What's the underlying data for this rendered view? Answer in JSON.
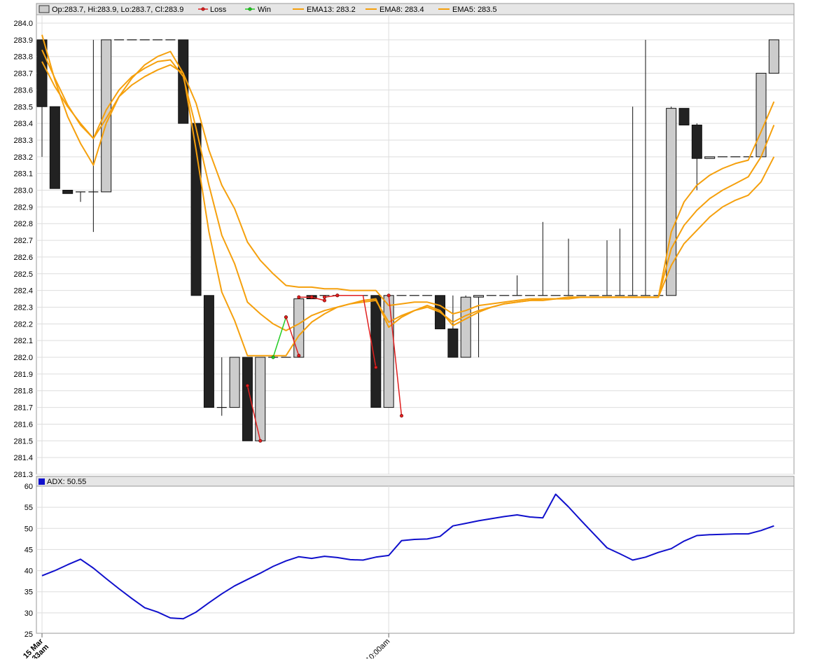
{
  "legend": {
    "ohlc": "Op:283.7, Hi:283.9, Lo:283.7, Cl:283.9",
    "loss": "Loss",
    "win": "Win",
    "ema13": "EMA13: 283.2",
    "ema8": "EMA8: 283.4",
    "ema5": "EMA5: 283.5",
    "adx": "ADX: 50.55"
  },
  "colors": {
    "bull": "#cccccc",
    "bear": "#222222",
    "ema": "#f5a00d",
    "loss": "#e02020",
    "win": "#22cc22",
    "adx": "#1010cc",
    "grid": "#dddddd",
    "frame": "#999999",
    "header": "#e6e6e6"
  },
  "x_labels": [
    {
      "i": 0,
      "line1": "15 Mar",
      "line2": "9:33am"
    },
    {
      "i": 27,
      "line1": "10:00am",
      "line2": ""
    }
  ],
  "chart_data": [
    {
      "type": "candlestick",
      "ylim": [
        281.3,
        284.0
      ],
      "yticks": [
        281.3,
        281.4,
        281.5,
        281.6,
        281.7,
        281.8,
        281.9,
        282.0,
        282.1,
        282.2,
        282.3,
        282.4,
        282.5,
        282.6,
        282.7,
        282.8,
        282.9,
        283.0,
        283.1,
        283.2,
        283.3,
        283.4,
        283.5,
        283.6,
        283.7,
        283.8,
        283.9,
        284.0
      ],
      "candles": [
        {
          "o": 283.9,
          "h": 283.9,
          "l": 283.2,
          "c": 283.5
        },
        {
          "o": 283.5,
          "h": 283.5,
          "l": 283.01,
          "c": 283.01
        },
        {
          "o": 283.0,
          "h": 283.0,
          "l": 282.98,
          "c": 282.98
        },
        {
          "o": 282.99,
          "h": 282.99,
          "l": 282.93,
          "c": 282.99
        },
        {
          "o": 282.99,
          "h": 283.9,
          "l": 282.75,
          "c": 282.99
        },
        {
          "o": 282.99,
          "h": 283.9,
          "l": 282.99,
          "c": 283.9
        },
        {
          "o": 283.9,
          "h": 283.9,
          "l": 283.9,
          "c": 283.9
        },
        {
          "o": 283.9,
          "h": 283.9,
          "l": 283.9,
          "c": 283.9
        },
        {
          "o": 283.9,
          "h": 283.9,
          "l": 283.9,
          "c": 283.9
        },
        {
          "o": 283.9,
          "h": 283.9,
          "l": 283.9,
          "c": 283.9
        },
        {
          "o": 283.9,
          "h": 283.9,
          "l": 283.9,
          "c": 283.9
        },
        {
          "o": 283.9,
          "h": 283.9,
          "l": 283.4,
          "c": 283.4
        },
        {
          "o": 283.4,
          "h": 283.4,
          "l": 282.37,
          "c": 282.37
        },
        {
          "o": 282.37,
          "h": 282.37,
          "l": 281.7,
          "c": 281.7
        },
        {
          "o": 281.7,
          "h": 282.0,
          "l": 281.65,
          "c": 281.7
        },
        {
          "o": 281.7,
          "h": 282.0,
          "l": 281.7,
          "c": 282.0
        },
        {
          "o": 282.0,
          "h": 282.0,
          "l": 281.5,
          "c": 281.5
        },
        {
          "o": 281.5,
          "h": 282.0,
          "l": 281.5,
          "c": 282.0
        },
        {
          "o": 282.0,
          "h": 282.0,
          "l": 282.0,
          "c": 282.0
        },
        {
          "o": 282.0,
          "h": 282.0,
          "l": 282.0,
          "c": 282.0
        },
        {
          "o": 282.0,
          "h": 282.37,
          "l": 282.0,
          "c": 282.35
        },
        {
          "o": 282.37,
          "h": 282.37,
          "l": 282.35,
          "c": 282.35
        },
        {
          "o": 282.37,
          "h": 282.37,
          "l": 282.37,
          "c": 282.37
        },
        {
          "o": 282.37,
          "h": 282.37,
          "l": 282.37,
          "c": 282.37
        },
        {
          "o": 282.37,
          "h": 282.37,
          "l": 282.37,
          "c": 282.37
        },
        {
          "o": 282.37,
          "h": 282.37,
          "l": 282.37,
          "c": 282.37
        },
        {
          "o": 282.37,
          "h": 282.37,
          "l": 281.7,
          "c": 281.7
        },
        {
          "o": 281.7,
          "h": 282.37,
          "l": 281.7,
          "c": 282.37
        },
        {
          "o": 282.37,
          "h": 282.37,
          "l": 282.37,
          "c": 282.37
        },
        {
          "o": 282.37,
          "h": 282.37,
          "l": 282.37,
          "c": 282.37
        },
        {
          "o": 282.37,
          "h": 282.37,
          "l": 282.37,
          "c": 282.37
        },
        {
          "o": 282.37,
          "h": 282.37,
          "l": 282.17,
          "c": 282.17
        },
        {
          "o": 282.17,
          "h": 282.37,
          "l": 282.0,
          "c": 282.0
        },
        {
          "o": 282.0,
          "h": 282.37,
          "l": 282.0,
          "c": 282.36
        },
        {
          "o": 282.36,
          "h": 282.37,
          "l": 282.0,
          "c": 282.37
        },
        {
          "o": 282.37,
          "h": 282.37,
          "l": 282.37,
          "c": 282.37
        },
        {
          "o": 282.37,
          "h": 282.37,
          "l": 282.37,
          "c": 282.37
        },
        {
          "o": 282.37,
          "h": 282.49,
          "l": 282.37,
          "c": 282.37
        },
        {
          "o": 282.37,
          "h": 282.37,
          "l": 282.37,
          "c": 282.37
        },
        {
          "o": 282.37,
          "h": 282.81,
          "l": 282.37,
          "c": 282.37
        },
        {
          "o": 282.37,
          "h": 282.37,
          "l": 282.37,
          "c": 282.37
        },
        {
          "o": 282.37,
          "h": 282.71,
          "l": 282.37,
          "c": 282.37
        },
        {
          "o": 282.37,
          "h": 282.37,
          "l": 282.37,
          "c": 282.37
        },
        {
          "o": 282.37,
          "h": 282.37,
          "l": 282.37,
          "c": 282.37
        },
        {
          "o": 282.37,
          "h": 282.7,
          "l": 282.37,
          "c": 282.37
        },
        {
          "o": 282.37,
          "h": 282.77,
          "l": 282.37,
          "c": 282.37
        },
        {
          "o": 282.37,
          "h": 283.5,
          "l": 282.37,
          "c": 282.37
        },
        {
          "o": 282.37,
          "h": 283.9,
          "l": 282.37,
          "c": 282.37
        },
        {
          "o": 282.37,
          "h": 282.37,
          "l": 282.37,
          "c": 282.37
        },
        {
          "o": 282.37,
          "h": 283.5,
          "l": 282.37,
          "c": 283.49
        },
        {
          "o": 283.49,
          "h": 283.49,
          "l": 283.39,
          "c": 283.39
        },
        {
          "o": 283.39,
          "h": 283.4,
          "l": 283.0,
          "c": 283.19
        },
        {
          "o": 283.19,
          "h": 283.2,
          "l": 283.19,
          "c": 283.2
        },
        {
          "o": 283.2,
          "h": 283.2,
          "l": 283.2,
          "c": 283.2
        },
        {
          "o": 283.2,
          "h": 283.2,
          "l": 283.2,
          "c": 283.2
        },
        {
          "o": 283.2,
          "h": 283.2,
          "l": 283.2,
          "c": 283.2
        },
        {
          "o": 283.2,
          "h": 283.7,
          "l": 283.2,
          "c": 283.7
        },
        {
          "o": 283.7,
          "h": 283.9,
          "l": 283.7,
          "c": 283.9
        }
      ],
      "series": [
        {
          "name": "EMA13",
          "values": [
            283.77,
            283.62,
            283.5,
            283.4,
            283.31,
            283.43,
            283.56,
            283.63,
            283.68,
            283.72,
            283.75,
            283.7,
            283.52,
            283.24,
            283.03,
            282.89,
            282.69,
            282.58,
            282.5,
            282.43,
            282.42,
            282.42,
            282.41,
            282.41,
            282.4,
            282.4,
            282.4,
            282.31,
            282.32,
            282.33,
            282.33,
            282.31,
            282.26,
            282.28,
            282.31,
            282.32,
            282.33,
            282.34,
            282.35,
            282.35,
            282.35,
            282.36,
            282.36,
            282.36,
            282.36,
            282.36,
            282.36,
            282.36,
            282.36,
            282.55,
            282.68,
            282.76,
            282.84,
            282.9,
            282.94,
            282.97,
            283.05,
            283.2
          ]
        },
        {
          "name": "EMA8",
          "values": [
            283.84,
            283.67,
            283.51,
            283.39,
            283.31,
            283.48,
            283.6,
            283.68,
            283.73,
            283.77,
            283.78,
            283.68,
            283.37,
            283.03,
            282.73,
            282.56,
            282.33,
            282.26,
            282.2,
            282.16,
            282.2,
            282.25,
            282.28,
            282.3,
            282.32,
            282.33,
            282.34,
            282.21,
            282.25,
            282.28,
            282.3,
            282.27,
            282.21,
            282.25,
            282.28,
            282.3,
            282.32,
            282.33,
            282.34,
            282.34,
            282.35,
            282.35,
            282.36,
            282.36,
            282.36,
            282.36,
            282.36,
            282.36,
            282.36,
            282.65,
            282.79,
            282.88,
            282.95,
            283.0,
            283.04,
            283.08,
            283.2,
            283.39
          ]
        },
        {
          "name": "EMA5",
          "values": [
            283.93,
            283.66,
            283.44,
            283.28,
            283.15,
            283.4,
            283.56,
            283.67,
            283.75,
            283.8,
            283.83,
            283.7,
            283.24,
            282.75,
            282.39,
            282.22,
            282.01,
            282.01,
            282.01,
            282.01,
            282.13,
            282.21,
            282.26,
            282.3,
            282.32,
            282.34,
            282.35,
            282.18,
            282.24,
            282.28,
            282.31,
            282.28,
            282.19,
            282.23,
            282.27,
            282.3,
            282.32,
            282.33,
            282.34,
            282.35,
            282.35,
            282.36,
            282.36,
            282.36,
            282.36,
            282.36,
            282.36,
            282.36,
            282.36,
            282.75,
            282.93,
            283.03,
            283.09,
            283.13,
            283.16,
            283.18,
            283.35,
            283.53
          ]
        }
      ],
      "trades": [
        {
          "name": "Loss",
          "points": [
            [
              16,
              281.83
            ],
            [
              17,
              281.5
            ]
          ]
        },
        {
          "name": "Win",
          "points": [
            [
              18,
              282.0
            ],
            [
              19,
              282.24
            ]
          ]
        },
        {
          "name": "Loss",
          "points": [
            [
              19,
              282.24
            ],
            [
              20,
              282.01
            ]
          ]
        },
        {
          "name": "Loss",
          "points": [
            [
              20,
              282.36
            ],
            [
              21,
              282.36
            ]
          ]
        },
        {
          "name": "Loss",
          "points": [
            [
              21,
              282.36
            ],
            [
              22,
              282.34
            ]
          ]
        },
        {
          "name": "Loss",
          "points": [
            [
              22,
              282.36
            ],
            [
              23,
              282.37
            ]
          ]
        },
        {
          "name": "Loss",
          "points": [
            [
              23,
              282.37
            ],
            [
              24,
              282.37
            ],
            [
              25,
              282.37
            ],
            [
              26,
              281.94
            ]
          ]
        },
        {
          "name": "Loss",
          "points": [
            [
              27,
              282.37
            ],
            [
              28,
              281.65
            ]
          ]
        }
      ]
    },
    {
      "type": "line",
      "ylim": [
        25,
        60
      ],
      "yticks": [
        25,
        30,
        35,
        40,
        45,
        50,
        55,
        60
      ],
      "series": [
        {
          "name": "ADX",
          "values": [
            38.8,
            40.0,
            41.4,
            42.7,
            40.6,
            38.1,
            35.7,
            33.4,
            31.2,
            30.2,
            28.8,
            28.6,
            30.2,
            32.4,
            34.5,
            36.4,
            37.9,
            39.4,
            41.0,
            42.3,
            43.3,
            42.9,
            43.4,
            43.1,
            42.6,
            42.5,
            43.2,
            43.6,
            47.1,
            47.4,
            47.5,
            48.1,
            50.6,
            51.2,
            51.8,
            52.3,
            52.8,
            53.2,
            52.7,
            52.5,
            58.1,
            55.1,
            51.8,
            48.6,
            45.4,
            44.0,
            42.5,
            43.2,
            44.3,
            45.2,
            47.0,
            48.3,
            48.5,
            48.6,
            48.7,
            48.7,
            49.5,
            50.6
          ]
        }
      ]
    }
  ]
}
